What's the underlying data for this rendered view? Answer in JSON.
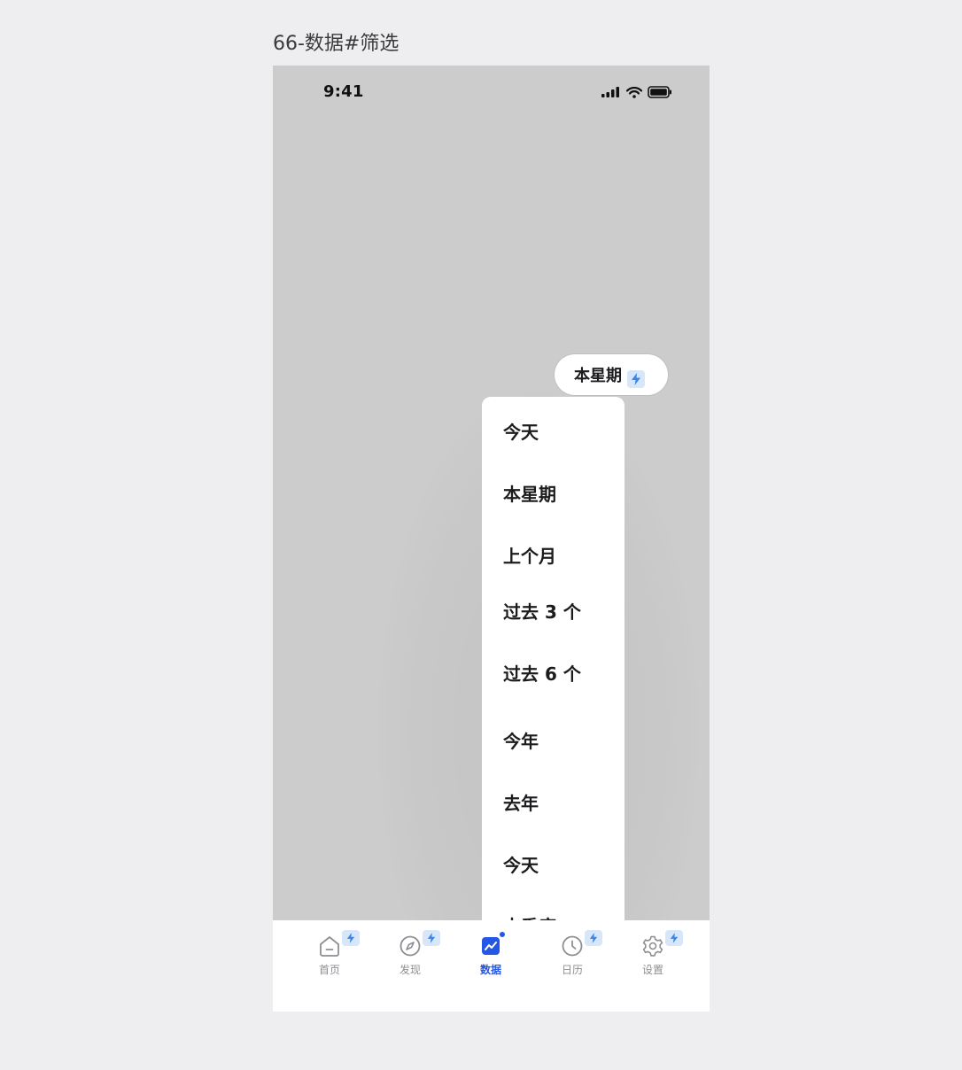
{
  "canvas_title": "66-数据#筛选",
  "status_bar": {
    "time": "9:41"
  },
  "filter_chip": {
    "label": "本星期"
  },
  "dropdown": {
    "items": [
      "今天",
      "本星期",
      "上个月",
      "过去 3 个月",
      "过去 6 个月",
      "今年",
      "去年",
      "今天",
      "本季度"
    ]
  },
  "tab_bar": {
    "tabs": [
      {
        "label": "首页",
        "icon": "home-icon"
      },
      {
        "label": "发现",
        "icon": "compass-icon"
      },
      {
        "label": "数据",
        "icon": "chart-icon",
        "active": true
      },
      {
        "label": "日历",
        "icon": "clock-icon"
      },
      {
        "label": "设置",
        "icon": "gear-icon"
      }
    ]
  },
  "colors": {
    "accent": "#2457e6",
    "badge": "#d7e6f8",
    "overlay": "#cccccc"
  }
}
